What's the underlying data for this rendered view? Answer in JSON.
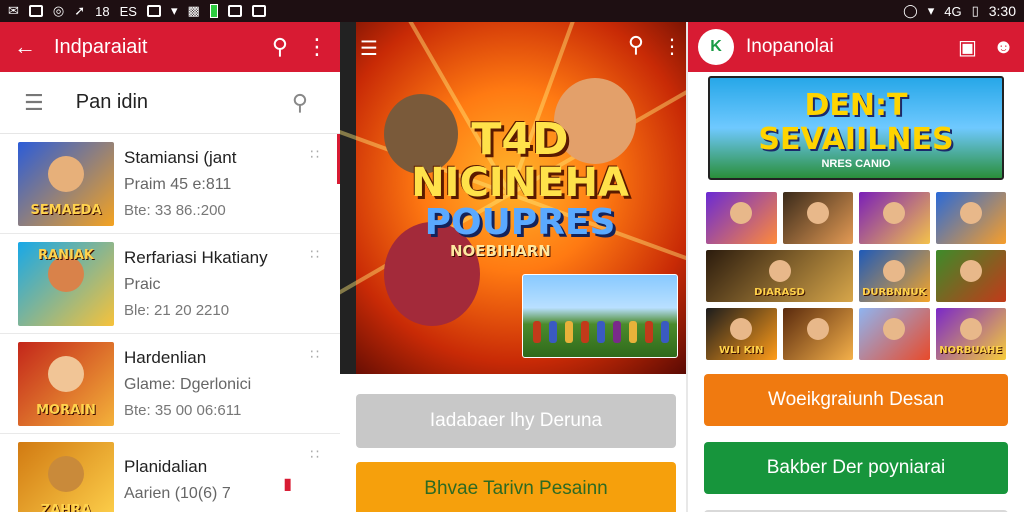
{
  "status_bar": {
    "left_glyphs": [
      "✉",
      "▣",
      "◎",
      "➚",
      "℗",
      "18",
      "ES",
      "■",
      "▾",
      "▥",
      "▩"
    ],
    "right_text": "⚬ ▾ 46‥ ▯ 3:30"
  },
  "panel1": {
    "appbar_title": "Indparaiait",
    "section_label": "Pan idin",
    "items": [
      {
        "name": "Stamiansi (jant",
        "sub": "Praim 45 e:811",
        "date": "Bte: 33 86.:200",
        "thumb_text": "SEMAEDA",
        "c1": "#2b5cd8",
        "c2": "#f4a321"
      },
      {
        "name": "Rerfariasi Hkatiany",
        "sub": "Praic",
        "date": "Ble: 21 20 2210",
        "thumb_text": "RANIAK",
        "c1": "#17a8e8",
        "c2": "#f7c23a"
      },
      {
        "name": "Hardenlian",
        "sub": "Glame: Dgerlonici",
        "date": "Bte: 35 00 06:611",
        "thumb_text": "MORAIN",
        "c1": "#c3261a",
        "c2": "#f4b23a"
      },
      {
        "name": "Planidalian",
        "sub": "Aarien (10(6) 7",
        "date": "",
        "thumb_text": "ZAHRA",
        "c1": "#d17a12",
        "c2": "#ffd34d"
      }
    ]
  },
  "panel2": {
    "hero_line1": "T4D",
    "hero_line2": "NICINEHA",
    "hero_line3": "POUPRES",
    "hero_sub": "NOEBIHARN",
    "button1": "Iadabaer lhy Deruna",
    "button2": "Bhvae Tarivn Pesainn"
  },
  "panel3": {
    "logo_text": "K",
    "title": "Inopanolai",
    "banner_line1": "DEN:T",
    "banner_line2": "SEVAIILNES",
    "banner_line3": "NRES CANIO",
    "tiles": [
      {
        "text": "",
        "c1": "#6a2ad4",
        "c2": "#ff8a3a",
        "wide": false
      },
      {
        "text": "",
        "c1": "#3a2a1a",
        "c2": "#e39a54",
        "wide": false
      },
      {
        "text": "",
        "c1": "#7a1fb8",
        "c2": "#f4c24a",
        "wide": false
      },
      {
        "text": "",
        "c1": "#2a6ad8",
        "c2": "#f79e2a",
        "wide": false
      },
      {
        "text": "DIARASD",
        "c1": "#2b1b0d",
        "c2": "#d7a64a",
        "wide": true
      },
      {
        "text": "DURBNNUK",
        "c1": "#1f5ab8",
        "c2": "#f4a52a",
        "wide": false
      },
      {
        "text": "",
        "c1": "#3d8b2a",
        "c2": "#c23a1a",
        "wide": false
      },
      {
        "text": "WLI KIN",
        "c1": "#1c1c1c",
        "c2": "#ff9c1a",
        "wide": false
      },
      {
        "text": "",
        "c1": "#5a2a0d",
        "c2": "#f4b04a",
        "wide": false
      },
      {
        "text": "",
        "c1": "#8fb4f0",
        "c2": "#e84a2a",
        "wide": false
      },
      {
        "text": "NORBUAHE",
        "c1": "#7a28c8",
        "c2": "#f7cc3a",
        "wide": false
      }
    ],
    "button1": "Woeikgraiunh Desan",
    "button2": "Bakber Der poyniarai"
  }
}
